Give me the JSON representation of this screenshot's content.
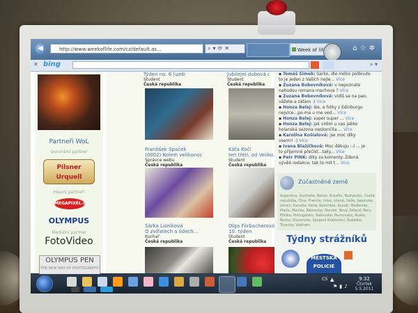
{
  "browser": {
    "address": "http://www.weekoflife.com/cz/default.as...",
    "tab_title": "Week of life - Zivot..."
  },
  "toolbar": {
    "search_brand": "bing"
  },
  "sidebar": {
    "partners_title": "Partneři WoL",
    "general_partner_label": "Generální partner",
    "main_partners_label": "Hlavní partneři",
    "media_partner_label": "Mediální partner",
    "logos": [
      "Pilsner Urquell",
      "MEGAPIXEL.CZ",
      "OLYMPUS",
      "FotoVideo",
      "OLYMPUS PEN"
    ],
    "pen_subtitle": "THE NEW WAY OF PHOTOGRAPHY"
  },
  "entries": [
    {
      "title": "Týden no. 6 (uzdraví ...",
      "role": "Student",
      "country": "Česká republika"
    },
    {
      "title": "Jubilejní dubová dvací...",
      "role": "Student",
      "country": "Česká republika"
    },
    {
      "title": "František Špaček",
      "title2": "(0002) Kolem velikonoc",
      "role": "Správce webu",
      "country": "Česká republika"
    },
    {
      "title": "Káťa Kočí",
      "title2": "ten třetí, od Veliko...",
      "role": "Student",
      "country": "Česká republika"
    },
    {
      "title": "Šárka Lisníková",
      "title2": "O zvířatech a lidech...",
      "role": "Kuchař",
      "country": "Česká republika"
    },
    {
      "title": "Olga Förbacherová",
      "title2": "10. týden",
      "role": "Student",
      "country": "Česká republika"
    }
  ],
  "comments": [
    {
      "author": "Tomáš Šimek:",
      "text": "Šarko, dle mého polbnute",
      "more": ""
    },
    {
      "author": "",
      "text": "to je jeden z Vašich nejle...",
      "more": "Více"
    },
    {
      "author": "Zuzana Bobovníková:",
      "text": "v nepoznate",
      "more": ""
    },
    {
      "author": "",
      "text": "nahodou romana machova ?",
      "more": "Více"
    },
    {
      "author": "Zuzana Bobovníková:",
      "text": "vidíš sa na pao,",
      "more": ""
    },
    {
      "author": "",
      "text": "vážete a záťam :)",
      "more": "Více"
    },
    {
      "author": "Honza Belej:",
      "text": "Iše, a fotky z Edinburgu",
      "more": ""
    },
    {
      "author": "",
      "text": "nejvice...po-me u me ved...",
      "more": "Více"
    },
    {
      "author": "Honza Belej:",
      "text": "super super ...",
      "more": "Více"
    },
    {
      "author": "Honza Belej:",
      "text": "jak vidim u vas jabko",
      "more": ""
    },
    {
      "author": "",
      "text": "holanská sezona neskončila ...",
      "more": "Více"
    },
    {
      "author": "Karolína Košíalová:",
      "text": "jse moc díky",
      "more": ""
    },
    {
      "author": "",
      "text": "vsem!! :)",
      "more": "Více"
    },
    {
      "author": "Ivana Blažíčková:",
      "text": "Moc děkuju :-) ... je",
      "more": ""
    },
    {
      "author": "",
      "text": "to příjemné přečíst...taky...",
      "more": "Více"
    },
    {
      "author": "Petr PINK:",
      "text": "díky za komenty. Zdená",
      "more": ""
    },
    {
      "author": "",
      "text": "vývěě redakce, tak to mit t...",
      "more": "Více"
    }
  ],
  "countries": {
    "title": "Zúčastněné země",
    "list": "Argentina, Austrálie, Belize, Brazílie, Bulharsko, Česká republika, Čína, Francie, Irsko, Island, Itálie, Japonsko, Jemen, Kanada, Keňa, Kolumbie, Kuvajt, Maďarsko, Malta, Mexiko, Německo, Norsko, Nový Zéland, Peru, Polsko, Portugalsko, Rakousko, Rumunsko, Rusko, Řecko, Slovensko, Spojené Království, Švédsko, Turecko, Vietnam"
  },
  "promo": {
    "title": "Týdny strážníků",
    "police_text": "MĚSTSKÁ POLICIE"
  },
  "taskbar": {
    "lang": "CS",
    "time": "9:32",
    "day": "Čtvrtek",
    "date": "5.5.2011"
  }
}
